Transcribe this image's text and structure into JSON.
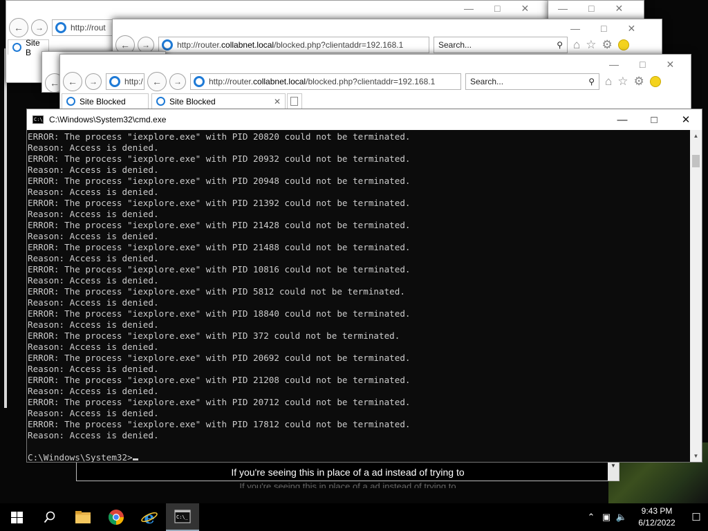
{
  "ie_windows": [
    {
      "address_text": "http://rout",
      "tab_label": "Site B"
    },
    {
      "address_prefix": "http://router.",
      "address_domain": "collabnet.local",
      "address_suffix": "/blocked.php?clientaddr=192.168.1",
      "search_placeholder": "Search..."
    },
    {
      "address_text": "http:/"
    },
    {
      "address_prefix": "http://router.",
      "address_domain": "collabnet.local",
      "address_suffix": "/blocked.php?clientaddr=192.168.1",
      "search_placeholder": "Search...",
      "tab1_label": "Site Blocked",
      "tab2_label": "Site Blocked"
    }
  ],
  "cmd": {
    "title": "C:\\Windows\\System32\\cmd.exe",
    "lines": [
      "ERROR: The process \"iexplore.exe\" with PID 20820 could not be terminated.",
      "Reason: Access is denied.",
      "ERROR: The process \"iexplore.exe\" with PID 20932 could not be terminated.",
      "Reason: Access is denied.",
      "ERROR: The process \"iexplore.exe\" with PID 20948 could not be terminated.",
      "Reason: Access is denied.",
      "ERROR: The process \"iexplore.exe\" with PID 21392 could not be terminated.",
      "Reason: Access is denied.",
      "ERROR: The process \"iexplore.exe\" with PID 21428 could not be terminated.",
      "Reason: Access is denied.",
      "ERROR: The process \"iexplore.exe\" with PID 21488 could not be terminated.",
      "Reason: Access is denied.",
      "ERROR: The process \"iexplore.exe\" with PID 10816 could not be terminated.",
      "Reason: Access is denied.",
      "ERROR: The process \"iexplore.exe\" with PID 5812 could not be terminated.",
      "Reason: Access is denied.",
      "ERROR: The process \"iexplore.exe\" with PID 18840 could not be terminated.",
      "Reason: Access is denied.",
      "ERROR: The process \"iexplore.exe\" with PID 372 could not be terminated.",
      "Reason: Access is denied.",
      "ERROR: The process \"iexplore.exe\" with PID 20692 could not be terminated.",
      "Reason: Access is denied.",
      "ERROR: The process \"iexplore.exe\" with PID 21208 could not be terminated.",
      "Reason: Access is denied.",
      "ERROR: The process \"iexplore.exe\" with PID 20712 could not be terminated.",
      "Reason: Access is denied.",
      "ERROR: The process \"iexplore.exe\" with PID 17812 could not be terminated.",
      "Reason: Access is denied.",
      "",
      "C:\\Windows\\System32>"
    ]
  },
  "ad": {
    "text": "If you're seeing this in place of a ad instead of trying to"
  },
  "taskbar": {
    "time": "9:43 PM",
    "date": "6/12/2022",
    "icons": [
      "windows-start-icon",
      "search-icon",
      "file-explorer-icon",
      "chrome-icon",
      "internet-explorer-icon",
      "cmd-icon"
    ]
  },
  "colors": {
    "cmd_bg": "#0c0c0c",
    "cmd_text": "#cccccc",
    "ie_blue": "#1e7ad6"
  }
}
